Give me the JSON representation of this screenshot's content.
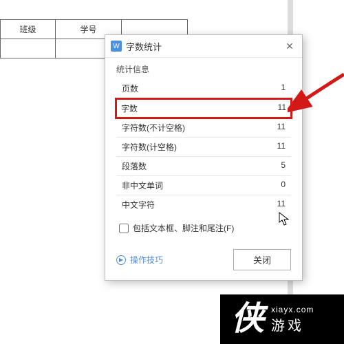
{
  "table": {
    "headers": [
      "班级",
      "学号"
    ]
  },
  "dialog": {
    "icon": "W",
    "title": "字数统计",
    "section_label": "统计信息",
    "rows": [
      {
        "label": "页数",
        "value": "1"
      },
      {
        "label": "字数",
        "value": "11"
      },
      {
        "label": "字符数(不计空格)",
        "value": "11"
      },
      {
        "label": "字符数(计空格)",
        "value": "11"
      },
      {
        "label": "段落数",
        "value": "5"
      },
      {
        "label": "非中文单词",
        "value": "0"
      },
      {
        "label": "中文字符",
        "value": "11"
      }
    ],
    "checkbox_label": "包括文本框、脚注和尾注(F)",
    "hint_label": "操作技巧",
    "close_label": "关闭"
  },
  "watermark": {
    "char": "侠",
    "cn": "游戏",
    "en": "xiayx.com"
  }
}
